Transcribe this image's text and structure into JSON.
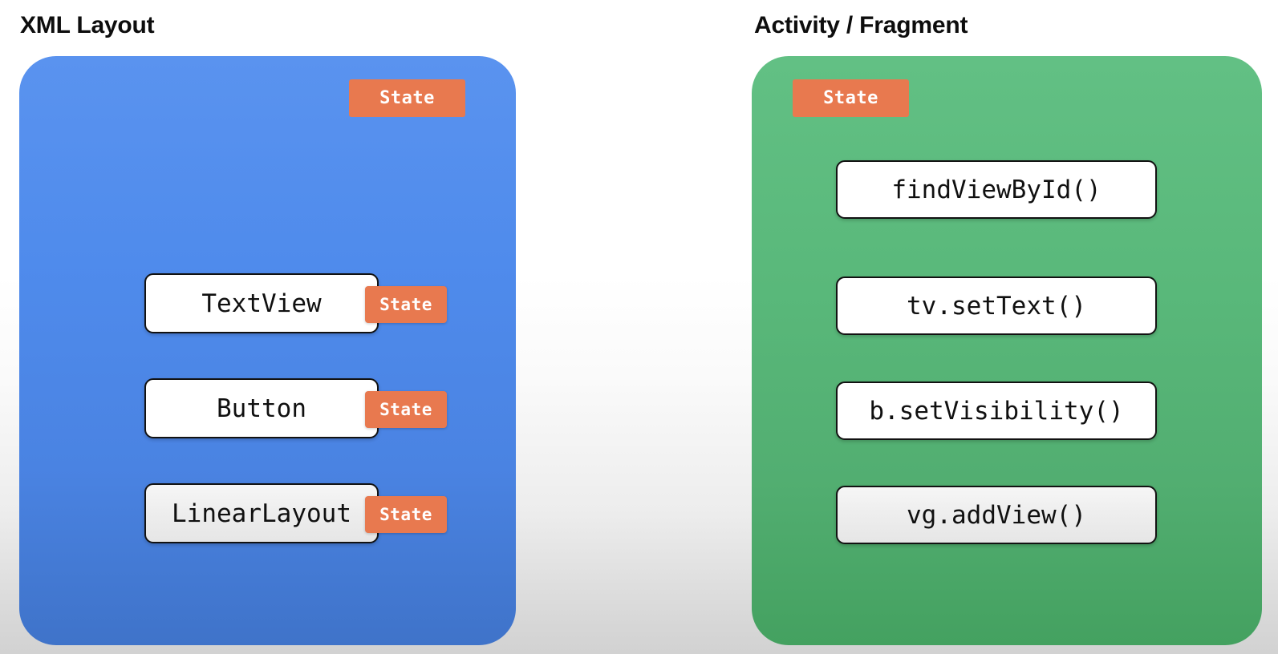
{
  "diagram": {
    "title_left": "XML Layout",
    "title_right": "Activity / Fragment",
    "state_label": "State",
    "colors": {
      "panel_xml": "#4f8bec",
      "panel_activity": "#59b87a",
      "state_badge": "#e8794f",
      "node_border": "#121212",
      "node_fill": "#ffffff",
      "node_fill_shaded": "#eeeeee",
      "title_text": "#0d0d0d",
      "background_top": "#ffffff",
      "background_bottom": "#d2d2d2"
    }
  },
  "left_panel": {
    "title": "XML Layout",
    "top_badge": "State",
    "nodes": [
      {
        "label": "TextView",
        "badge": "State",
        "shaded": false
      },
      {
        "label": "Button",
        "badge": "State",
        "shaded": false
      },
      {
        "label": "LinearLayout",
        "badge": "State",
        "shaded": true
      }
    ]
  },
  "right_panel": {
    "title": "Activity / Fragment",
    "top_badge": "State",
    "nodes": [
      {
        "label": "findViewById()",
        "shaded": false
      },
      {
        "label": "tv.setText()",
        "shaded": false
      },
      {
        "label": "b.setVisibility()",
        "shaded": false
      },
      {
        "label": "vg.addView()",
        "shaded": true
      }
    ]
  }
}
